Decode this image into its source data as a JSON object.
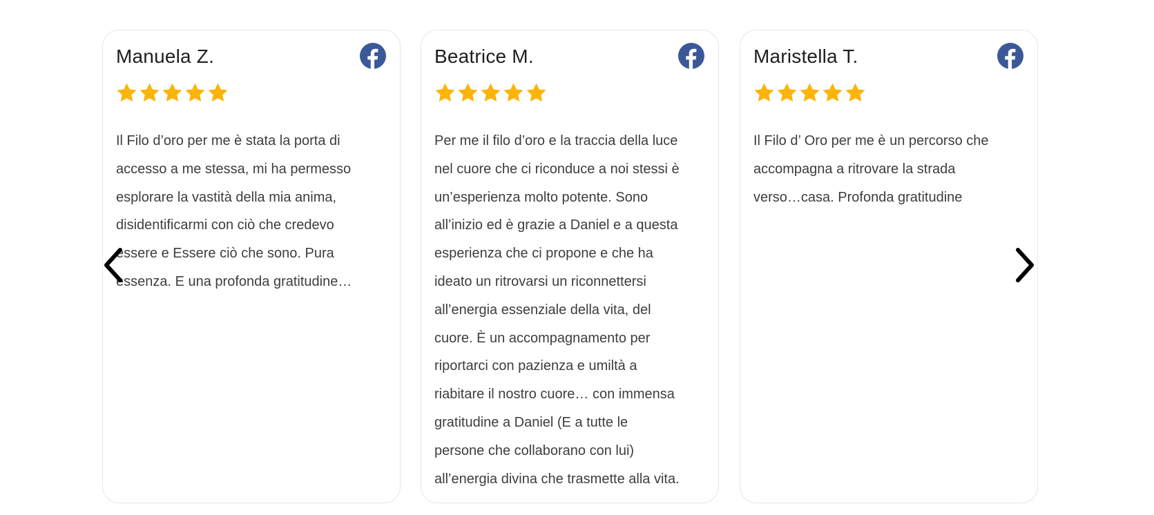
{
  "colors": {
    "star": "#FBB40A",
    "facebook": "#3B5998",
    "card_border": "#E6E6E6",
    "arrow": "#000000"
  },
  "icons": {
    "platform": "facebook-icon",
    "rating": "star-icon",
    "prev": "chevron-left-icon",
    "next": "chevron-right-icon"
  },
  "reviews": [
    {
      "name": "Manuela Z.",
      "rating": 5,
      "text": "Il Filo d’oro per me è stata la porta di\naccesso a me stessa, mi ha permesso\nesplorare la vastità della mia anima,\ndisidentificarmi con ciò che credevo\nessere e Essere ciò che sono. Pura\nessenza. E una profonda gratitudine…"
    },
    {
      "name": "Beatrice M.",
      "rating": 5,
      "text": "Per me il filo d’oro e la traccia della luce\nnel cuore che ci riconduce a noi stessi è\nun’esperienza molto potente. Sono\nall’inizio ed è grazie a Daniel e a questa\nesperienza che ci propone e che ha\nideato un ritrovarsi un riconnettersi\nall’energia essenziale della vita, del\ncuore. È un accompagnamento per\nriportarci con pazienza e umiltà a\nriabitare il nostro cuore… con immensa\ngratitudine a Daniel (E a tutte le\npersone che collaborano con lui)\nall’energia divina che trasmette alla vita."
    },
    {
      "name": "Maristella T.",
      "rating": 5,
      "text": "Il Filo d’ Oro per me è un percorso che\naccompagna a ritrovare la strada\nverso…casa. Profonda gratitudine"
    }
  ]
}
